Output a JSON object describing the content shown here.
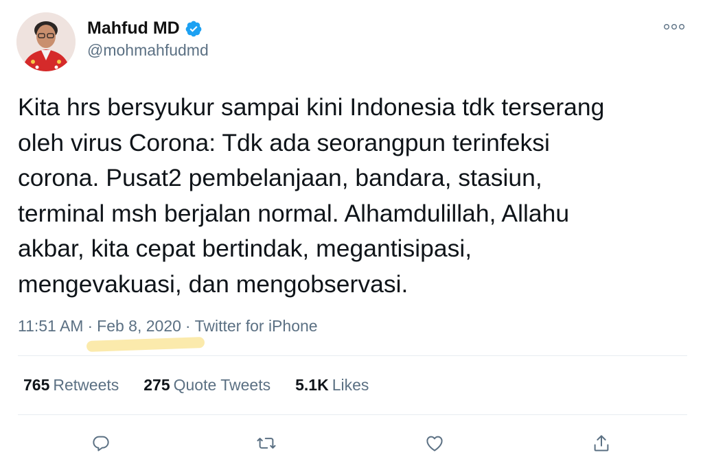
{
  "author": {
    "display_name": "Mahfud MD",
    "handle": "@mohmahfudmd",
    "verified": true
  },
  "tweet": {
    "text": "Kita hrs bersyukur sampai kini Indonesia tdk terserang\noleh virus Corona: Tdk ada seorangpun terinfeksi\ncorona. Pusat2 pembelanjaan, bandara, stasiun,\nterminal msh berjalan normal. Alhamdulillah, Allahu\nakbar, kita cepat bertindak, megantisipasi,\nmengevakuasi, dan mengobservasi.",
    "time": "11:51 AM",
    "separator": "·",
    "date": "Feb 8, 2020",
    "source": "Twitter for iPhone"
  },
  "stats": {
    "retweets": {
      "count": "765",
      "label": "Retweets"
    },
    "quote_tweets": {
      "count": "275",
      "label": "Quote Tweets"
    },
    "likes": {
      "count": "5.1K",
      "label": "Likes"
    }
  },
  "colors": {
    "text": "#0f1419",
    "secondary": "#5b7083",
    "verified_blue": "#1da1f2",
    "highlight": "#fbe9a8",
    "divider": "#e6ecf0"
  },
  "icons": {
    "more": "more-horizontal-icon",
    "reply": "reply-icon",
    "retweet": "retweet-icon",
    "like": "heart-icon",
    "share": "share-icon",
    "verified": "verified-badge-icon"
  }
}
